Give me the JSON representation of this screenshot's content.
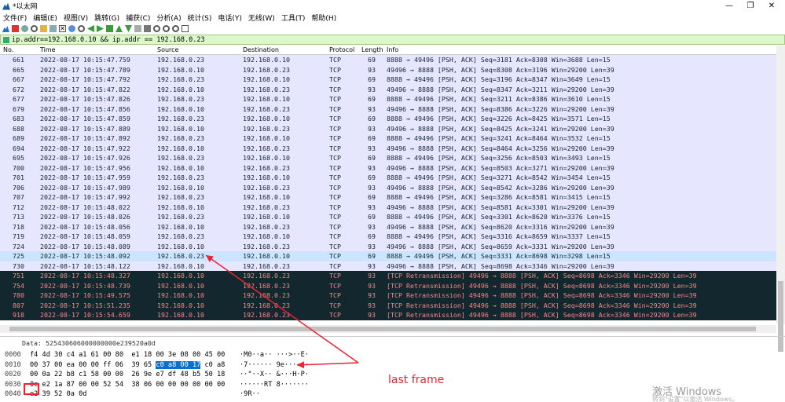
{
  "window": {
    "title": "*以太网",
    "minimize": "—",
    "maximize": "❐",
    "close": "✕"
  },
  "menu": [
    "文件(F)",
    "编辑(E)",
    "视图(V)",
    "跳转(G)",
    "捕获(C)",
    "分析(A)",
    "统计(S)",
    "电话(Y)",
    "无线(W)",
    "工具(T)",
    "帮助(H)"
  ],
  "filter": {
    "value": "ip.addr==192.168.0.10 && ip.addr == 192.168.0.23"
  },
  "columns": {
    "no": "No.",
    "time": "Time",
    "source": "Source",
    "destination": "Destination",
    "protocol": "Protocol",
    "length": "Length",
    "info": "Info"
  },
  "packets": [
    {
      "no": "661",
      "time": "2022-08-17 10:15:47.759",
      "src": "192.168.0.23",
      "dst": "192.168.0.10",
      "proto": "TCP",
      "len": "69",
      "info": "8888 → 49496 [PSH, ACK] Seq=3181 Ack=8308 Win=3688 Len=15",
      "style": "norm"
    },
    {
      "no": "665",
      "time": "2022-08-17 10:15:47.789",
      "src": "192.168.0.10",
      "dst": "192.168.0.23",
      "proto": "TCP",
      "len": "93",
      "info": "49496 → 8888 [PSH, ACK] Seq=8308 Ack=3196 Win=29200 Len=39",
      "style": "norm"
    },
    {
      "no": "667",
      "time": "2022-08-17 10:15:47.792",
      "src": "192.168.0.23",
      "dst": "192.168.0.10",
      "proto": "TCP",
      "len": "69",
      "info": "8888 → 49496 [PSH, ACK] Seq=3196 Ack=8347 Win=3649 Len=15",
      "style": "norm"
    },
    {
      "no": "672",
      "time": "2022-08-17 10:15:47.822",
      "src": "192.168.0.10",
      "dst": "192.168.0.23",
      "proto": "TCP",
      "len": "93",
      "info": "49496 → 8888 [PSH, ACK] Seq=8347 Ack=3211 Win=29200 Len=39",
      "style": "norm"
    },
    {
      "no": "677",
      "time": "2022-08-17 10:15:47.826",
      "src": "192.168.0.23",
      "dst": "192.168.0.10",
      "proto": "TCP",
      "len": "69",
      "info": "8888 → 49496 [PSH, ACK] Seq=3211 Ack=8386 Win=3610 Len=15",
      "style": "norm"
    },
    {
      "no": "679",
      "time": "2022-08-17 10:15:47.856",
      "src": "192.168.0.10",
      "dst": "192.168.0.23",
      "proto": "TCP",
      "len": "93",
      "info": "49496 → 8888 [PSH, ACK] Seq=8386 Ack=3226 Win=29200 Len=39",
      "style": "norm"
    },
    {
      "no": "683",
      "time": "2022-08-17 10:15:47.859",
      "src": "192.168.0.23",
      "dst": "192.168.0.10",
      "proto": "TCP",
      "len": "69",
      "info": "8888 → 49496 [PSH, ACK] Seq=3226 Ack=8425 Win=3571 Len=15",
      "style": "norm"
    },
    {
      "no": "688",
      "time": "2022-08-17 10:15:47.889",
      "src": "192.168.0.10",
      "dst": "192.168.0.23",
      "proto": "TCP",
      "len": "93",
      "info": "49496 → 8888 [PSH, ACK] Seq=8425 Ack=3241 Win=29200 Len=39",
      "style": "norm"
    },
    {
      "no": "689",
      "time": "2022-08-17 10:15:47.892",
      "src": "192.168.0.23",
      "dst": "192.168.0.10",
      "proto": "TCP",
      "len": "69",
      "info": "8888 → 49496 [PSH, ACK] Seq=3241 Ack=8464 Win=3532 Len=15",
      "style": "norm"
    },
    {
      "no": "694",
      "time": "2022-08-17 10:15:47.922",
      "src": "192.168.0.10",
      "dst": "192.168.0.23",
      "proto": "TCP",
      "len": "93",
      "info": "49496 → 8888 [PSH, ACK] Seq=8464 Ack=3256 Win=29200 Len=39",
      "style": "norm"
    },
    {
      "no": "695",
      "time": "2022-08-17 10:15:47.926",
      "src": "192.168.0.23",
      "dst": "192.168.0.10",
      "proto": "TCP",
      "len": "69",
      "info": "8888 → 49496 [PSH, ACK] Seq=3256 Ack=8503 Win=3493 Len=15",
      "style": "norm"
    },
    {
      "no": "700",
      "time": "2022-08-17 10:15:47.956",
      "src": "192.168.0.10",
      "dst": "192.168.0.23",
      "proto": "TCP",
      "len": "93",
      "info": "49496 → 8888 [PSH, ACK] Seq=8503 Ack=3271 Win=29200 Len=39",
      "style": "norm"
    },
    {
      "no": "701",
      "time": "2022-08-17 10:15:47.959",
      "src": "192.168.0.23",
      "dst": "192.168.0.10",
      "proto": "TCP",
      "len": "69",
      "info": "8888 → 49496 [PSH, ACK] Seq=3271 Ack=8542 Win=3454 Len=15",
      "style": "norm"
    },
    {
      "no": "706",
      "time": "2022-08-17 10:15:47.989",
      "src": "192.168.0.10",
      "dst": "192.168.0.23",
      "proto": "TCP",
      "len": "93",
      "info": "49496 → 8888 [PSH, ACK] Seq=8542 Ack=3286 Win=29200 Len=39",
      "style": "norm"
    },
    {
      "no": "707",
      "time": "2022-08-17 10:15:47.992",
      "src": "192.168.0.23",
      "dst": "192.168.0.10",
      "proto": "TCP",
      "len": "69",
      "info": "8888 → 49496 [PSH, ACK] Seq=3286 Ack=8581 Win=3415 Len=15",
      "style": "norm"
    },
    {
      "no": "712",
      "time": "2022-08-17 10:15:48.022",
      "src": "192.168.0.10",
      "dst": "192.168.0.23",
      "proto": "TCP",
      "len": "93",
      "info": "49496 → 8888 [PSH, ACK] Seq=8581 Ack=3301 Win=29200 Len=39",
      "style": "norm"
    },
    {
      "no": "713",
      "time": "2022-08-17 10:15:48.026",
      "src": "192.168.0.23",
      "dst": "192.168.0.10",
      "proto": "TCP",
      "len": "69",
      "info": "8888 → 49496 [PSH, ACK] Seq=3301 Ack=8620 Win=3376 Len=15",
      "style": "norm"
    },
    {
      "no": "718",
      "time": "2022-08-17 10:15:48.056",
      "src": "192.168.0.10",
      "dst": "192.168.0.23",
      "proto": "TCP",
      "len": "93",
      "info": "49496 → 8888 [PSH, ACK] Seq=8620 Ack=3316 Win=29200 Len=39",
      "style": "norm"
    },
    {
      "no": "719",
      "time": "2022-08-17 10:15:48.059",
      "src": "192.168.0.23",
      "dst": "192.168.0.10",
      "proto": "TCP",
      "len": "69",
      "info": "8888 → 49496 [PSH, ACK] Seq=3316 Ack=8659 Win=3337 Len=15",
      "style": "norm"
    },
    {
      "no": "724",
      "time": "2022-08-17 10:15:48.089",
      "src": "192.168.0.10",
      "dst": "192.168.0.23",
      "proto": "TCP",
      "len": "93",
      "info": "49496 → 8888 [PSH, ACK] Seq=8659 Ack=3331 Win=29200 Len=39",
      "style": "norm"
    },
    {
      "no": "725",
      "time": "2022-08-17 10:15:48.092",
      "src": "192.168.0.23",
      "dst": "192.168.0.10",
      "proto": "TCP",
      "len": "69",
      "info": "8888 → 49496 [PSH, ACK] Seq=3331 Ack=8698 Win=3298 Len=15",
      "style": "sel"
    },
    {
      "no": "730",
      "time": "2022-08-17 10:15:48.122",
      "src": "192.168.0.10",
      "dst": "192.168.0.23",
      "proto": "TCP",
      "len": "93",
      "info": "49496 → 8888 [PSH, ACK] Seq=8698 Ack=3346 Win=29200 Len=39",
      "style": "norm"
    },
    {
      "no": "751",
      "time": "2022-08-17 10:15:48.327",
      "src": "192.168.0.10",
      "dst": "192.168.0.23",
      "proto": "TCP",
      "len": "93",
      "info": "[TCP Retransmission] 49496 → 8888 [PSH, ACK] Seq=8698 Ack=3346 Win=29200 Len=39",
      "style": "retx"
    },
    {
      "no": "754",
      "time": "2022-08-17 10:15:48.739",
      "src": "192.168.0.10",
      "dst": "192.168.0.23",
      "proto": "TCP",
      "len": "93",
      "info": "[TCP Retransmission] 49496 → 8888 [PSH, ACK] Seq=8698 Ack=3346 Win=29200 Len=39",
      "style": "retx"
    },
    {
      "no": "780",
      "time": "2022-08-17 10:15:49.575",
      "src": "192.168.0.10",
      "dst": "192.168.0.23",
      "proto": "TCP",
      "len": "93",
      "info": "[TCP Retransmission] 49496 → 8888 [PSH, ACK] Seq=8698 Ack=3346 Win=29200 Len=39",
      "style": "retx"
    },
    {
      "no": "807",
      "time": "2022-08-17 10:15:51.235",
      "src": "192.168.0.10",
      "dst": "192.168.0.23",
      "proto": "TCP",
      "len": "93",
      "info": "[TCP Retransmission] 49496 → 8888 [PSH, ACK] Seq=8698 Ack=3346 Win=29200 Len=39",
      "style": "retx"
    },
    {
      "no": "918",
      "time": "2022-08-17 10:15:54.659",
      "src": "192.168.0.10",
      "dst": "192.168.0.23",
      "proto": "TCP",
      "len": "93",
      "info": "[TCP Retransmission] 49496 → 8888 [PSH, ACK] Seq=8698 Ack=3346 Win=29200 Len=39",
      "style": "retx"
    }
  ],
  "detail_line": "Data: 525430606000000000e239520a0d",
  "hex_rows": [
    {
      "offset": "0000",
      "pre": "f4 4d 30 c4 a1 61 00 80  e1 18 00 3e 08 00 45 00",
      "hl": "",
      "post": "",
      "ascii": "·M0··a·· ···>··E·"
    },
    {
      "offset": "0010",
      "pre": "00 37 00 ea 00 00 ff 06  39 65 ",
      "hl": "c0 a8 00 17",
      "post": " c0 a8",
      "ascii": "·7······ 9e······"
    },
    {
      "offset": "0020",
      "pre": "00 0a 22 b8 c1 58 00 00  26 9e e7 df 48 b5 50 18",
      "hl": "",
      "post": "",
      "ascii": "··\"··X·· &···H·P·"
    },
    {
      "offset": "0030",
      "pre": "0c e2 1a 87 00 00 52 54  38 06 00 00 00 00 00 00",
      "hl": "",
      "post": "",
      "ascii": "······RT 8·······"
    },
    {
      "offset": "0040",
      "pre": "e2 39 52 0a 0d",
      "hl": "",
      "post": "",
      "ascii": "·9R··"
    }
  ],
  "annotation": "last frame",
  "watermark": {
    "line1": "激活 Windows",
    "line2": "转到\"设置\"以激活 Windows。"
  },
  "colors": {
    "normal_bg": "#e7e6ff",
    "selected_bg": "#cce5ff",
    "retx_bg": "#12272e",
    "retx_fg": "#f78787",
    "filter_bg": "#dcf7c8",
    "annot": "#e23"
  }
}
